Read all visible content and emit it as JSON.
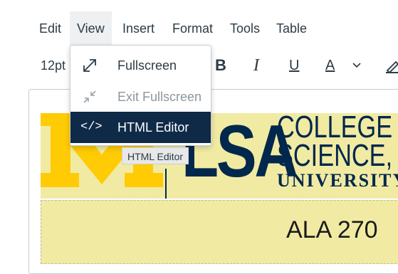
{
  "menubar": {
    "items": [
      {
        "label": "Edit"
      },
      {
        "label": "View"
      },
      {
        "label": "Insert"
      },
      {
        "label": "Format"
      },
      {
        "label": "Tools"
      },
      {
        "label": "Table"
      }
    ],
    "active": "View"
  },
  "toolbar": {
    "font_size": "12pt",
    "bold_label": "B",
    "italic_label": "I",
    "underline_label": "U",
    "text_color_label": "A"
  },
  "view_menu": {
    "items": [
      {
        "label": "Fullscreen",
        "icon": "expand-icon",
        "state": "enabled"
      },
      {
        "label": "Exit Fullscreen",
        "icon": "collapse-icon",
        "state": "disabled"
      },
      {
        "label": "HTML Editor",
        "icon": "code-icon",
        "icon_glyph": "</>",
        "state": "highlighted"
      }
    ]
  },
  "tooltip": {
    "text": "HTML Editor"
  },
  "banner": {
    "logo_letters": "LSA",
    "line1": "COLLEGE O",
    "line2": "SCIENCE, A",
    "line3": "UNIVERSITY",
    "colors": {
      "maize": "#ffcb05",
      "banner_bg": "#f1eaa3",
      "navy": "#00274c"
    }
  },
  "content": {
    "course_code": "ALA 270"
  },
  "colors": {
    "menu_highlight": "#0e2a47",
    "text": "#2d3b45",
    "disabled_text": "#8b969e"
  }
}
